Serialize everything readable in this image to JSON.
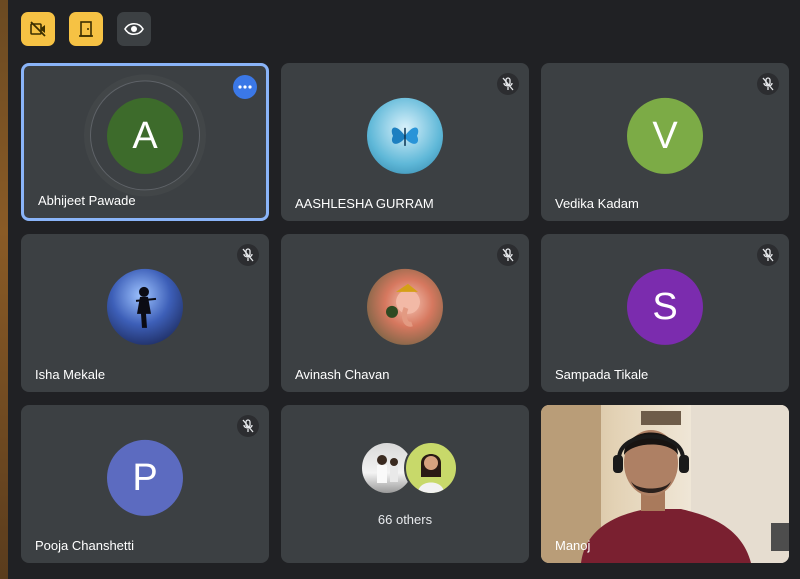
{
  "toolbar": {
    "buttons": [
      {
        "icon": "video-off-icon",
        "color": "#f6c244"
      },
      {
        "icon": "exit-door-icon",
        "color": "#f6c244"
      },
      {
        "icon": "eye-icon",
        "color": "#3c4043"
      }
    ]
  },
  "participants": [
    {
      "name": "Abhijeet Pawade",
      "initial": "A",
      "color": "#3d6b2b",
      "active": true,
      "muted": false
    },
    {
      "name": "AASHLESHA GURRAM",
      "initial": "",
      "avatar": "butterfly-image",
      "muted": true
    },
    {
      "name": "Vedika Kadam",
      "initial": "V",
      "color": "#7cab46",
      "muted": true
    },
    {
      "name": "Isha Mekale",
      "initial": "",
      "avatar": "silhouette-image",
      "muted": true
    },
    {
      "name": "Avinash Chavan",
      "initial": "",
      "avatar": "ganesha-image",
      "muted": true
    },
    {
      "name": "Sampada Tikale",
      "initial": "S",
      "color": "#7b2cae",
      "muted": true
    },
    {
      "name": "Pooja Chanshetti",
      "initial": "P",
      "color": "#5c6bc0",
      "muted": true
    }
  ],
  "others_tile": {
    "label": "66 others"
  },
  "video_tile": {
    "name": "Manoj"
  },
  "colors": {
    "background": "#202124",
    "tile": "#3c4043",
    "active_border": "#8ab4f8",
    "more_button": "#3b78e7"
  }
}
